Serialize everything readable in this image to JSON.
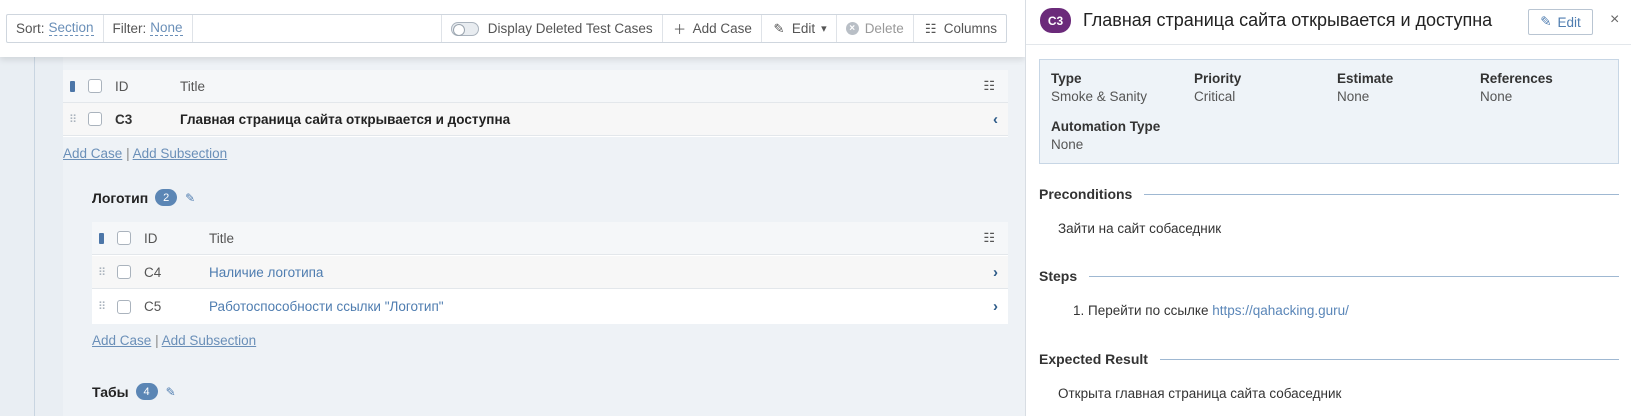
{
  "toolbar": {
    "sort_label": "Sort:",
    "sort_value": "Section",
    "filter_label": "Filter:",
    "filter_value": "None",
    "display_deleted": "Display Deleted Test Cases",
    "add_case": "Add Case",
    "edit": "Edit",
    "delete": "Delete",
    "columns": "Columns"
  },
  "top_table": {
    "header": {
      "id": "ID",
      "title": "Title"
    },
    "rows": [
      {
        "id": "C3",
        "title": "Главная страница сайта открывается и доступна"
      }
    ]
  },
  "links": {
    "add_case": "Add Case",
    "separator": "|",
    "add_subsection": "Add Subsection"
  },
  "sections": [
    {
      "name": "Логотип",
      "count": "2",
      "header": {
        "id": "ID",
        "title": "Title"
      },
      "rows": [
        {
          "id": "C4",
          "title": "Наличие логотипа"
        },
        {
          "id": "C5",
          "title": "Работоспособности ссылки \"Логотип\""
        }
      ]
    },
    {
      "name": "Табы",
      "count": "4"
    }
  ],
  "detail": {
    "badge": "C3",
    "title": "Главная страница сайта открывается и доступна",
    "edit_label": "Edit",
    "close": "×",
    "props": [
      {
        "key": "Type",
        "value": "Smoke & Sanity"
      },
      {
        "key": "Priority",
        "value": "Critical"
      },
      {
        "key": "Estimate",
        "value": "None"
      },
      {
        "key": "References",
        "value": "None"
      },
      {
        "key": "Automation Type",
        "value": "None"
      }
    ],
    "preconditions_label": "Preconditions",
    "preconditions_text": "Зайти на сайт собаседник",
    "steps_label": "Steps",
    "step_num": "1.",
    "step_text": "Перейти по ссылке",
    "step_url": "https://qahacking.guru/",
    "expected_label": "Expected Result",
    "expected_text": "Открыта главная страница сайта собаседник"
  }
}
